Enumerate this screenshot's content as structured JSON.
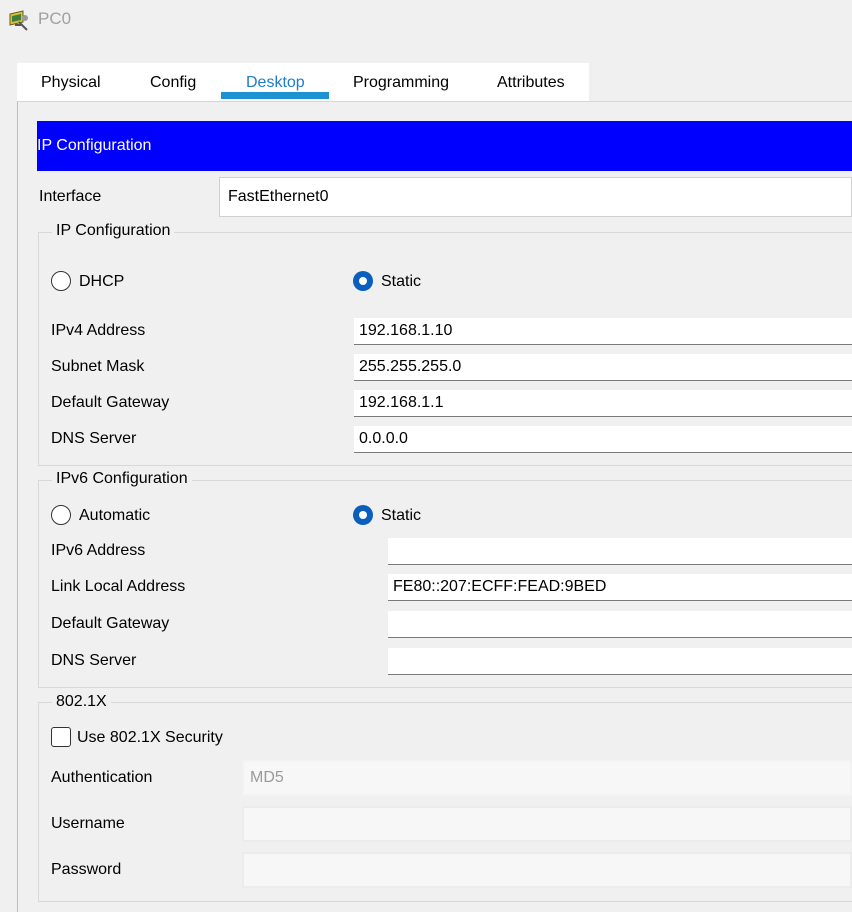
{
  "window": {
    "title": "PC0",
    "icon": "pc-device-icon"
  },
  "tabs": [
    {
      "label": "Physical",
      "active": false
    },
    {
      "label": "Config",
      "active": false
    },
    {
      "label": "Desktop",
      "active": true
    },
    {
      "label": "Programming",
      "active": false
    },
    {
      "label": "Attributes",
      "active": false
    }
  ],
  "banner": {
    "title": "IP Configuration",
    "color": "#0000ff"
  },
  "interface": {
    "label": "Interface",
    "value": "FastEthernet0"
  },
  "ipv4": {
    "legend": "IP Configuration",
    "mode_dhcp": "DHCP",
    "mode_static": "Static",
    "selected": "Static",
    "ipv4_address": {
      "label": "IPv4 Address",
      "value": "192.168.1.10"
    },
    "subnet_mask": {
      "label": "Subnet Mask",
      "value": "255.255.255.0"
    },
    "default_gateway": {
      "label": "Default Gateway",
      "value": "192.168.1.1"
    },
    "dns_server": {
      "label": "DNS Server",
      "value": "0.0.0.0"
    }
  },
  "ipv6": {
    "legend": "IPv6 Configuration",
    "mode_auto": "Automatic",
    "mode_static": "Static",
    "selected": "Static",
    "ipv6_address": {
      "label": "IPv6 Address",
      "value": ""
    },
    "link_local": {
      "label": "Link Local Address",
      "value": "FE80::207:ECFF:FEAD:9BED"
    },
    "default_gateway": {
      "label": "Default Gateway",
      "value": ""
    },
    "dns_server": {
      "label": "DNS Server",
      "value": ""
    }
  },
  "dot1x": {
    "legend": "802.1X",
    "use_security": {
      "label": "Use 802.1X Security",
      "checked": false
    },
    "authentication": {
      "label": "Authentication",
      "value": "MD5"
    },
    "username": {
      "label": "Username",
      "value": ""
    },
    "password": {
      "label": "Password",
      "value": ""
    }
  },
  "colors": {
    "accent": "#1e93d2",
    "banner": "#0000ff",
    "radio_selected": "#0a5fbe"
  }
}
